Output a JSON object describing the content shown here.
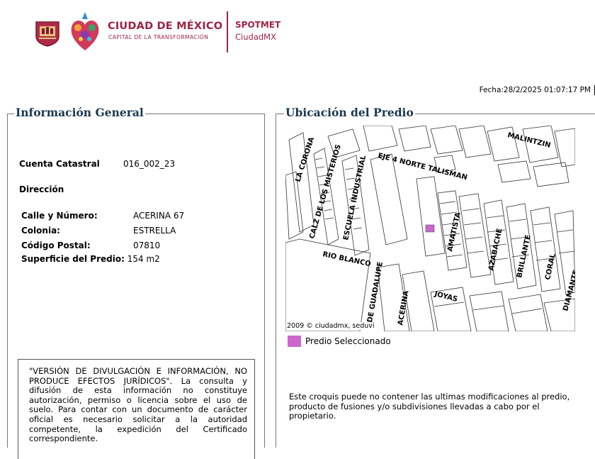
{
  "header": {
    "city_name": "CIUDAD DE MÉXICO",
    "city_tagline": "CAPITAL DE LA TRANSFORMACIÓN",
    "app_name": "SPOTMET",
    "app_subtitle": "CiudadMX",
    "brand_color": "#9c2444"
  },
  "fecha": "Fecha:28/2/2025 01:07:17 PM",
  "general": {
    "legend": "Información General",
    "cuenta_label": "Cuenta Catastral",
    "cuenta_value": "016_002_23",
    "direccion_label": "Dirección",
    "fields": [
      {
        "label": "Calle y Número:",
        "value": "ACERINA 67"
      },
      {
        "label": "Colonia:",
        "value": "ESTRELLA"
      },
      {
        "label": "Código Postal:",
        "value": "07810"
      }
    ],
    "superficie_label": "Superficie del Predio:",
    "superficie_value": "154 m2",
    "disclaimer": "\"VERSIÓN DE DIVULGACIÓN E INFORMACIÓN, NO PRODUCE EFECTOS JURÍDICOS\". La consulta y difusión de esta información no constituye autorización, permiso o licencia sobre el uso de suelo. Para contar con un documento de carácter oficial es necesario solicitar a la autoridad competente, la expedición del Certificado correspondiente."
  },
  "ubicacion": {
    "legend": "Ubicación del Predio",
    "streets": {
      "malintzin": "MALINTZIN",
      "corona": "LA CORONA",
      "misterios": "CALZ DE LOS MISTERIOS",
      "industrial": "ESCUELA INDUSTRIAL",
      "eje4": "EJE 4 NORTE TALISMAN",
      "amatista": "AMATISTA",
      "azabache": "AZABACHE",
      "brillante": "BRILLANTE",
      "coral": "CORAL",
      "rio_blanco": "RIO BLANCO",
      "guadalupe": "DE GUADALUPE",
      "acerina": "ACERINA",
      "joyas": "JOYAS",
      "diamante": "DIAMANTE"
    },
    "copyright": "2009 © ciudadmx, seduvi",
    "legend_label": "Predio Seleccionado",
    "selected_color": "#cc66cc",
    "note": "Este croquis puede no contener las ultimas modificaciones al predio, producto de fusiones y/o subdivisiones llevadas a cabo por el propietario."
  }
}
